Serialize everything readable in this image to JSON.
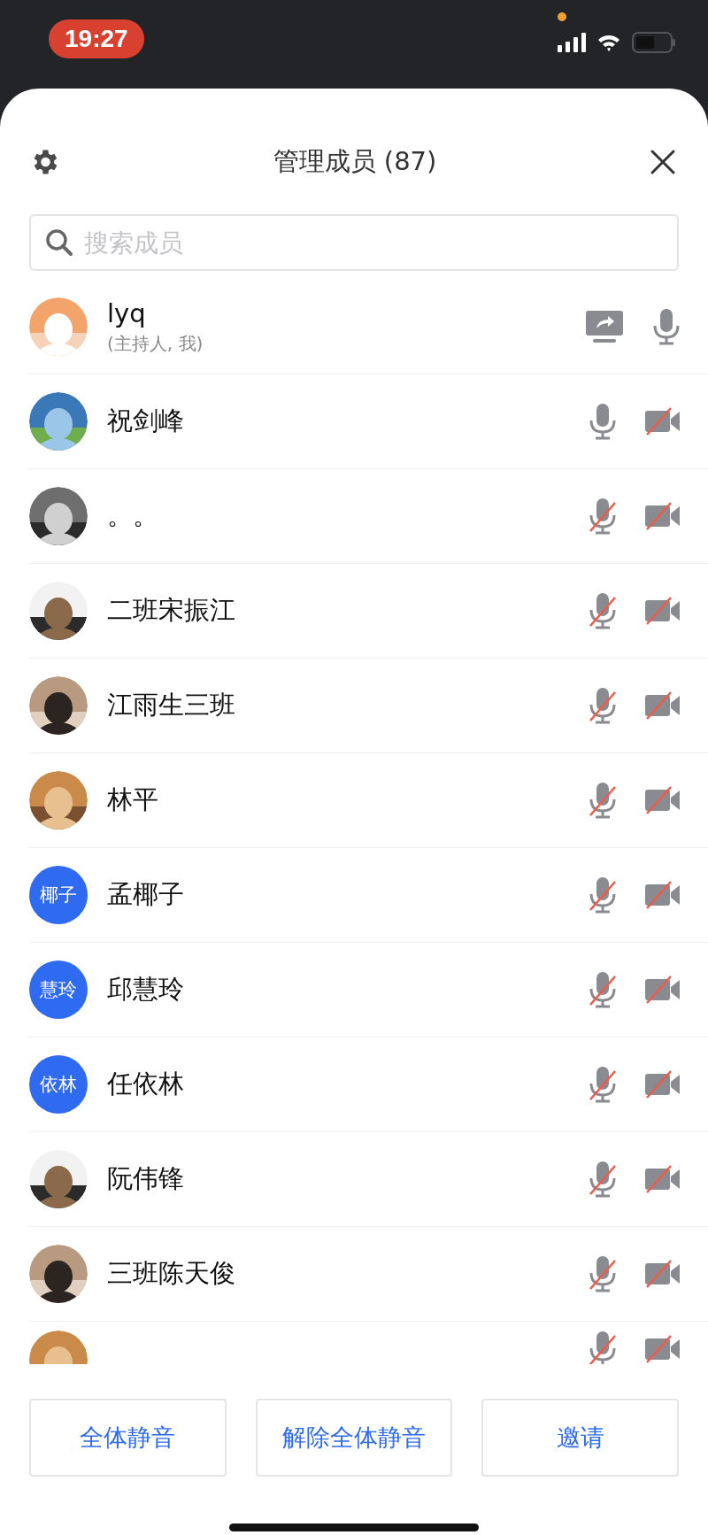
{
  "status_bar": {
    "time": "19:27"
  },
  "header": {
    "title": "管理成员 (87)"
  },
  "search": {
    "placeholder": "搜索成员"
  },
  "members": [
    {
      "kind": "host",
      "name": "lyq",
      "subtitle": "(主持人, 我)",
      "mic_muted": false
    },
    {
      "kind": "member",
      "name": "祝剑峰",
      "mic_muted": false,
      "video_muted": true
    },
    {
      "kind": "member",
      "name": "。。",
      "mic_muted": true,
      "video_muted": true
    },
    {
      "kind": "member",
      "name": "二班宋振江",
      "mic_muted": true,
      "video_muted": true
    },
    {
      "kind": "member",
      "name": "江雨生三班",
      "mic_muted": true,
      "video_muted": true
    },
    {
      "kind": "member",
      "name": "林平",
      "mic_muted": true,
      "video_muted": true
    },
    {
      "kind": "member",
      "name": "孟椰子",
      "avatar": {
        "kind": "initials",
        "text": "椰子",
        "color": "#2f6bf0"
      },
      "mic_muted": true,
      "video_muted": true
    },
    {
      "kind": "member",
      "name": "邱慧玲",
      "avatar": {
        "kind": "initials",
        "text": "慧玲",
        "color": "#2f6bf0"
      },
      "mic_muted": true,
      "video_muted": true
    },
    {
      "kind": "member",
      "name": "任依林",
      "avatar": {
        "kind": "initials",
        "text": "依林",
        "color": "#2f6bf0"
      },
      "mic_muted": true,
      "video_muted": true
    },
    {
      "kind": "member",
      "name": "阮伟锋",
      "mic_muted": true,
      "video_muted": true
    },
    {
      "kind": "member",
      "name": "三班陈天俊",
      "mic_muted": true,
      "video_muted": true
    },
    {
      "kind": "partial",
      "mic_muted": true,
      "video_muted": true
    }
  ],
  "buttons": [
    {
      "label": "全体静音"
    },
    {
      "label": "解除全体静音"
    },
    {
      "label": "邀请"
    }
  ]
}
